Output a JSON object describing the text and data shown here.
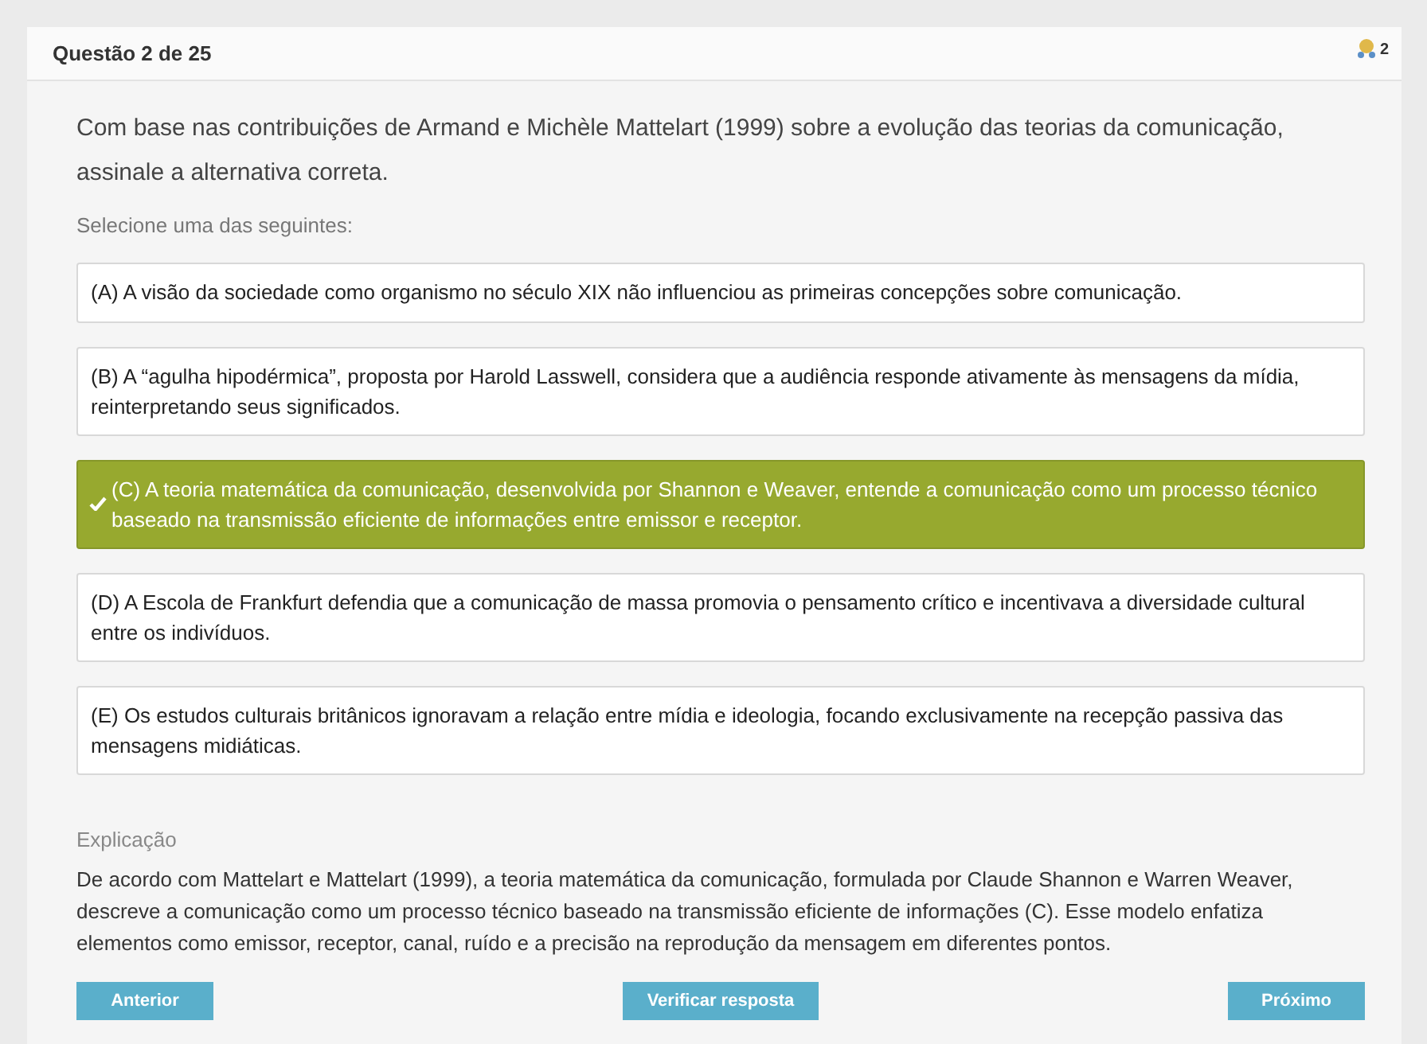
{
  "header": {
    "title": "Questão 2 de 25",
    "badge_count": "2"
  },
  "question": "Com base nas contribuições de Armand e Michèle Mattelart (1999) sobre a evolução das teorias da comunicação, assinale a alternativa correta.",
  "instruction": "Selecione uma das seguintes:",
  "options": [
    {
      "text": "(A) A visão da sociedade como organismo no século XIX não influenciou as primeiras concepções sobre comunicação.",
      "selected": false
    },
    {
      "text": "(B) A “agulha hipodérmica”, proposta por Harold Lasswell, considera que a audiência responde ativamente às mensagens da mídia, reinterpretando seus significados.",
      "selected": false
    },
    {
      "text": "(C) A teoria matemática da comunicação, desenvolvida por Shannon e Weaver, entende a comunicação como um processo técnico baseado na transmissão eficiente de informações entre emissor e receptor.",
      "selected": true
    },
    {
      "text": "(D) A Escola de Frankfurt defendia que a comunicação de massa promovia o pensamento crítico e incentivava a diversidade cultural entre os indivíduos.",
      "selected": false
    },
    {
      "text": "(E) Os estudos culturais britânicos ignoravam a relação entre mídia e ideologia, focando exclusivamente na recepção passiva das mensagens midiáticas.",
      "selected": false
    }
  ],
  "explanation": {
    "heading": "Explicação",
    "text": "De acordo com Mattelart e Mattelart (1999), a teoria matemática da comunicação, formulada por Claude Shannon e Warren Weaver, descreve a comunicação como um processo técnico baseado na transmissão eficiente de informações (C). Esse modelo enfatiza elementos como emissor, receptor, canal, ruído e a precisão na reprodução da mensagem em diferentes pontos."
  },
  "buttons": [
    "Anterior",
    "Verificar resposta",
    "Próximo"
  ]
}
